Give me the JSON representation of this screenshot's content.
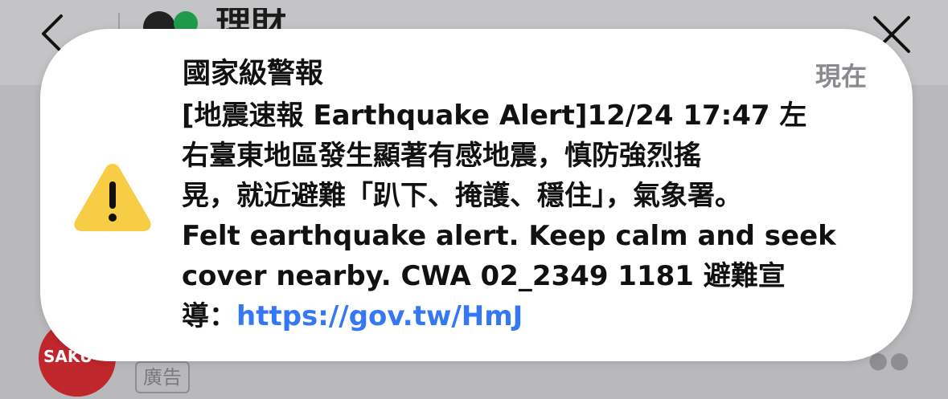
{
  "header": {
    "back_icon": "chevron-left-icon",
    "close_icon": "close-icon",
    "app_title": "理財"
  },
  "alert": {
    "title": "國家級警報",
    "time": "現在",
    "icon": "warning-icon",
    "body_lines": [
      "[地震速報 Earthquake Alert]12/24 17:47 左",
      "右臺東地區發生顯著有感地震，慎防強烈搖",
      "晃，就近避難「趴下、掩護、穩住」，氣象署。",
      "Felt earthquake alert. Keep calm and seek",
      "cover nearby. CWA 02_2349 1181 避難宣"
    ],
    "last_line_prefix": "導：",
    "link_text": "https://gov.tw/HmJ",
    "link_color": "#3478f6"
  },
  "background": {
    "ad_logo_text": "SAKU",
    "ad_label": "廣告",
    "more_icon": "more-dots-icon"
  }
}
